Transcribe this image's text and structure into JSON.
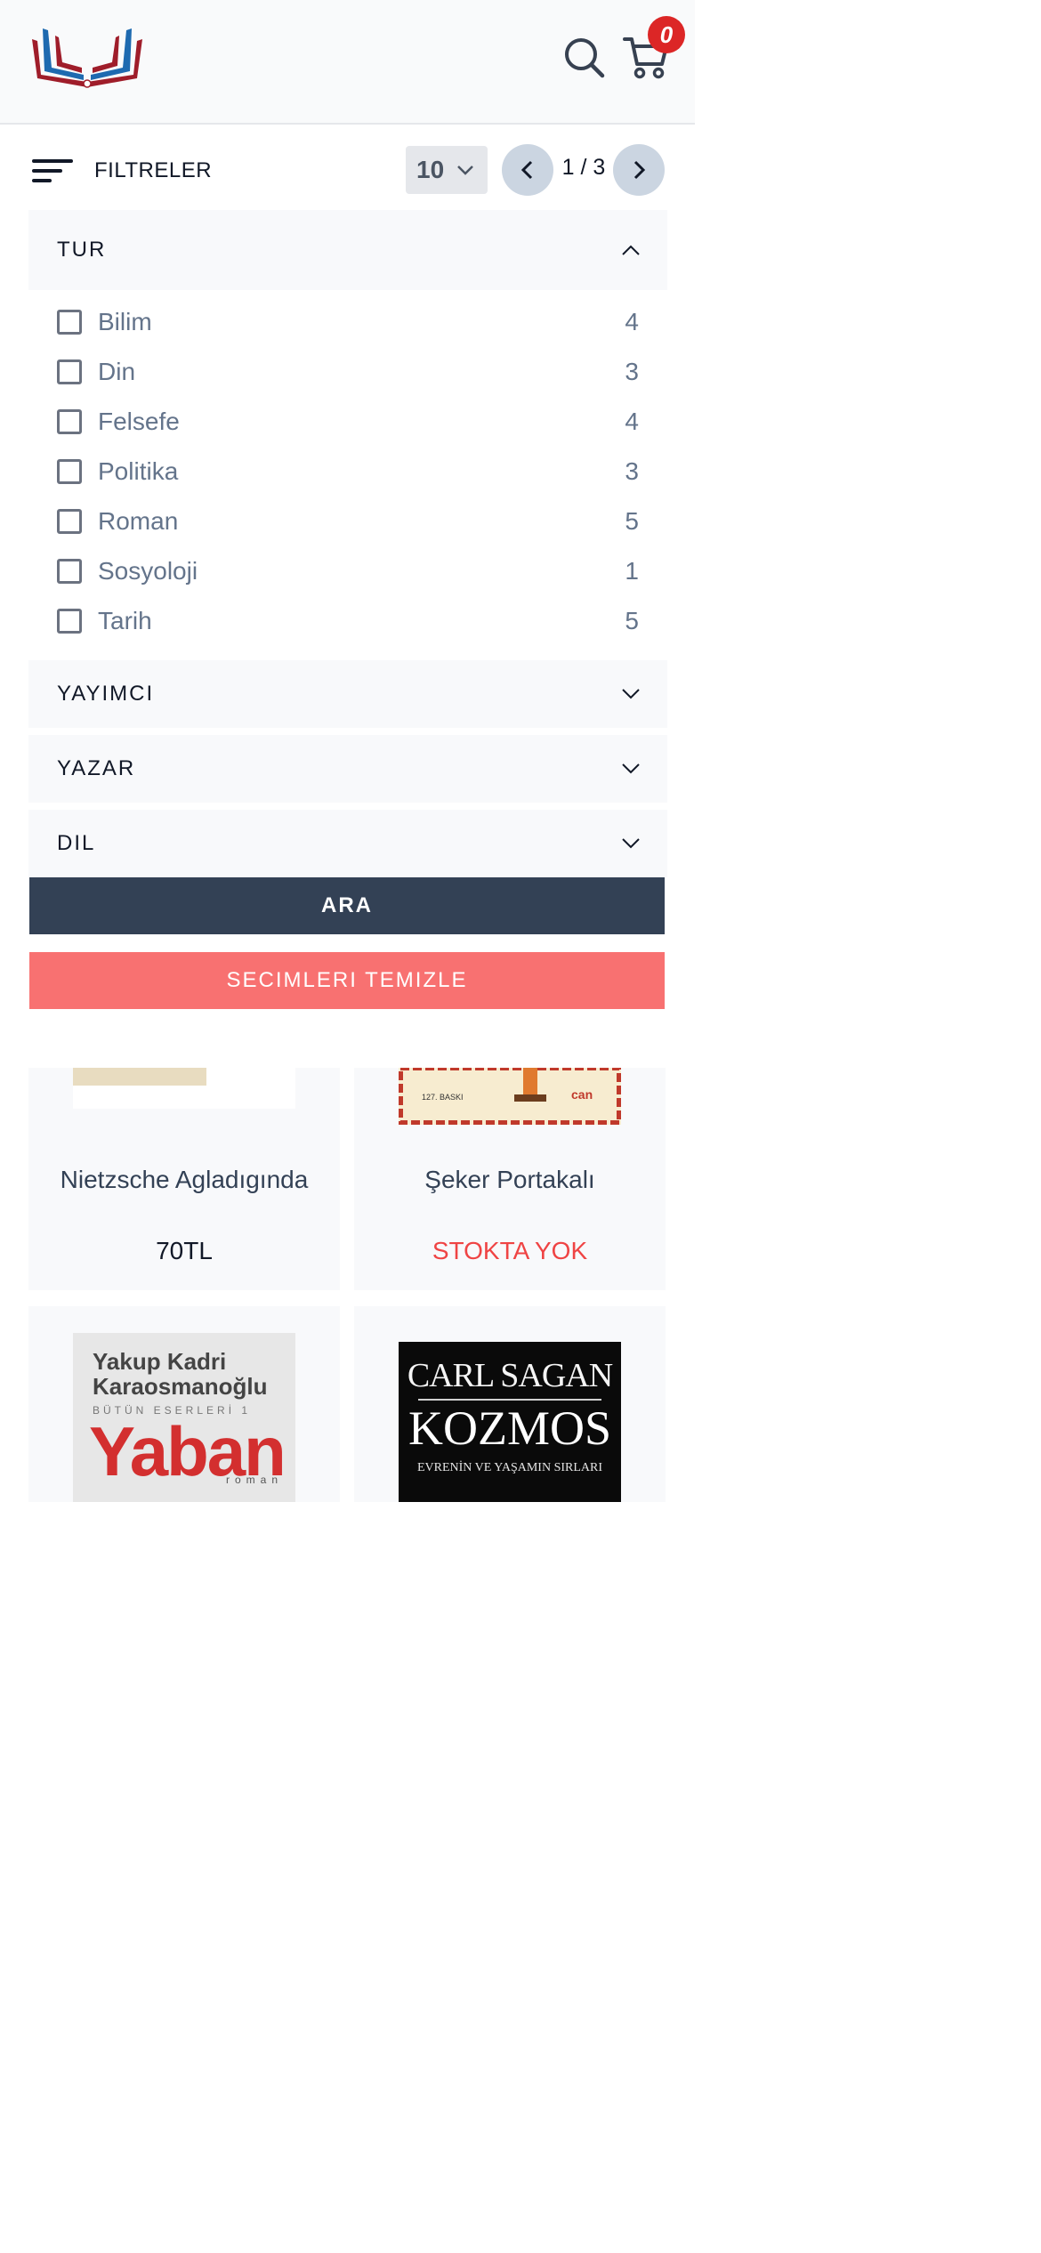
{
  "header": {
    "cart_count": "0",
    "colors": {
      "brand_red": "#9f1d2a",
      "brand_blue": "#1e6ab0",
      "badge": "#dc2626"
    }
  },
  "toolbar": {
    "filter_label": "FILTRELER",
    "per_page_value": "10",
    "page_indicator": "1 / 3"
  },
  "filters": {
    "tur": {
      "title": "TUR",
      "expanded": true,
      "options": [
        {
          "label": "Bilim",
          "count": "4"
        },
        {
          "label": "Din",
          "count": "3"
        },
        {
          "label": "Felsefe",
          "count": "4"
        },
        {
          "label": "Politika",
          "count": "3"
        },
        {
          "label": "Roman",
          "count": "5"
        },
        {
          "label": "Sosyoloji",
          "count": "1"
        },
        {
          "label": "Tarih",
          "count": "5"
        }
      ]
    },
    "yayimci": {
      "title": "YAYIMCI"
    },
    "yazar": {
      "title": "YAZAR"
    },
    "dil": {
      "title": "DIL"
    }
  },
  "actions": {
    "search_label": "ARA",
    "clear_label": "SECIMLERI TEMIZLE"
  },
  "products": [
    {
      "title": "Nietzsche Agladıgında",
      "price": "70TL"
    },
    {
      "title": "Şeker Portakalı",
      "price": "STOKTA YOK",
      "cover_text": [
        "127. BASKI",
        "can"
      ]
    },
    {
      "cover": {
        "author": "Yakup Kadri Karaosmanoğlu",
        "series": "BÜTÜN ESERLERİ 1",
        "title": "Yaban",
        "genre": "roman"
      }
    },
    {
      "cover": {
        "author": "CARL SAGAN",
        "title": "KOZMOS",
        "subtitle": "EVRENİN VE YAŞAMIN SIRLARI"
      }
    }
  ]
}
